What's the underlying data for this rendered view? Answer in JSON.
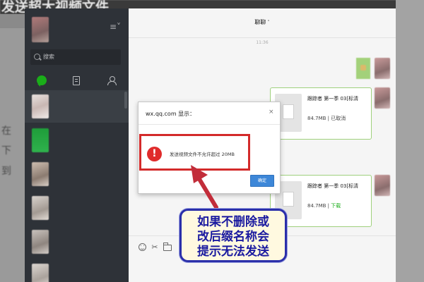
{
  "backdrop": {
    "title": "发送超大视频文件",
    "fragments": [
      "在",
      "下",
      "到"
    ]
  },
  "sidebar": {
    "menu_icon": "≡˅",
    "search_placeholder": "搜索",
    "tabs": [
      "chat-icon",
      "document-icon",
      "contacts-icon"
    ]
  },
  "chat": {
    "header_title": "聊聊",
    "header_caret": "˅",
    "timestamp": "11:36",
    "files": [
      {
        "name": "跟踪者 第一季 03[标清",
        "size": "84.7MB",
        "divider": " | ",
        "status": "已取消"
      },
      {
        "name": "跟踪者 第一季 03[标清",
        "size": "84.7MB",
        "divider": " | ",
        "status": "下载"
      }
    ],
    "toolbar_icons": [
      "emoji-icon",
      "scissors-icon",
      "folder-icon"
    ],
    "scissors_glyph": "✂"
  },
  "dialog": {
    "title": "wx.qq.com 显示：",
    "close": "×",
    "alert_glyph": "!",
    "message": "发送视频文件不允许超过 20MB",
    "ok_label": "确定"
  },
  "annotation": {
    "lines": [
      "如果不删除或",
      "改后缀名称会",
      "提示无法发送"
    ]
  },
  "colors": {
    "accent_green": "#1aad19",
    "alert_red": "#e02b2b",
    "highlight_red": "#d32a2a",
    "button_blue": "#3d87d8",
    "callout_text": "#1a1aa0"
  }
}
